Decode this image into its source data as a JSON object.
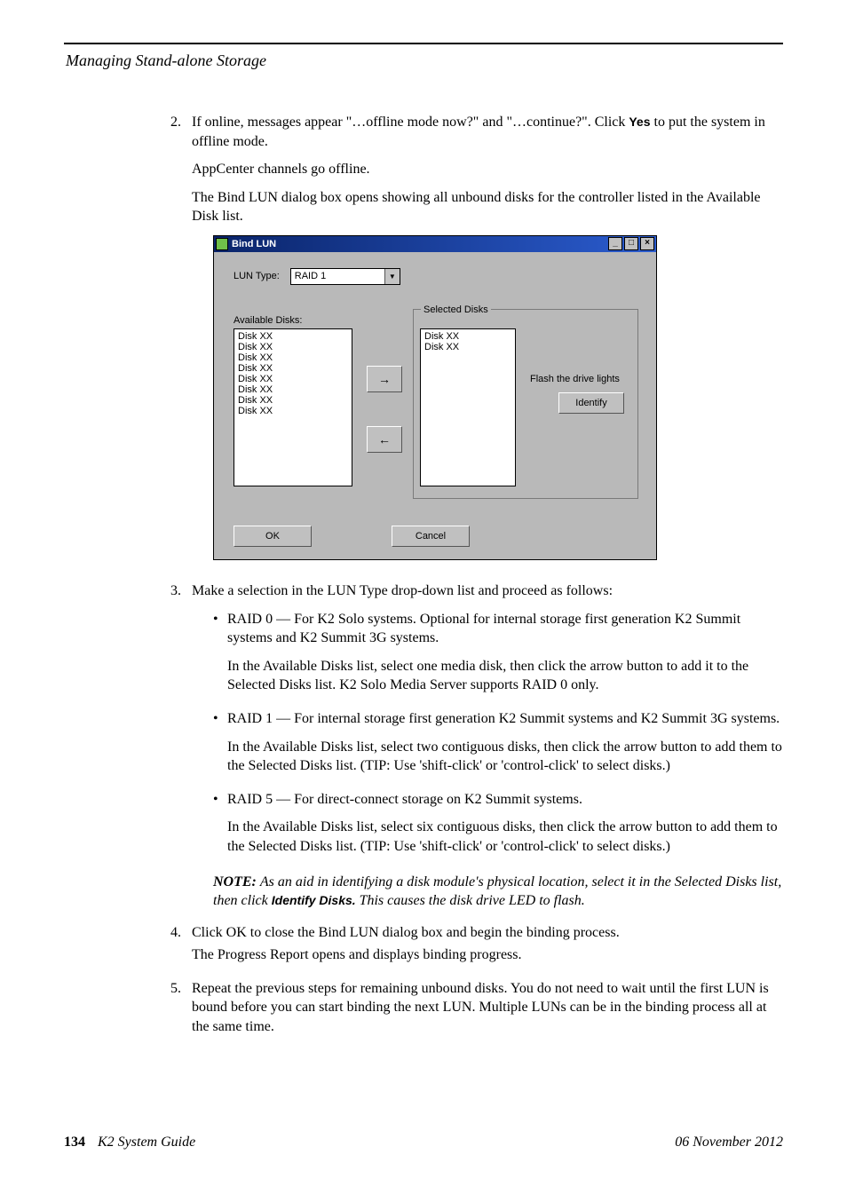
{
  "header": {
    "section_title": "Managing Stand-alone Storage"
  },
  "steps": {
    "s2": {
      "num": "2.",
      "line1a": "If online, messages appear \"…offline mode now?\" and \"…continue?\". Click ",
      "yes": "Yes",
      "line1b": " to put the system in offline mode.",
      "line2": "AppCenter channels go offline.",
      "line3": "The Bind LUN dialog box opens showing all unbound disks for the controller listed in the Available Disk list."
    },
    "s3": {
      "num": "3.",
      "intro": "Make a selection in the LUN Type drop-down list and proceed as follows:",
      "raid0_a": "RAID 0 — For K2 Solo systems. Optional for internal storage first generation K2 Summit systems and K2 Summit 3G systems.",
      "raid0_b": "In the Available Disks list, select one media disk, then click the arrow button to add it to the Selected Disks list. K2 Solo Media Server supports RAID 0 only.",
      "raid1_a": "RAID 1 — For internal storage first generation K2 Summit systems and K2 Summit 3G systems.",
      "raid1_b": "In the Available Disks list, select two contiguous disks, then click the arrow button to add them to the Selected Disks list. (TIP: Use 'shift-click' or 'control-click' to select disks.)",
      "raid5_a": "RAID 5 — For direct-connect storage on K2 Summit systems.",
      "raid5_b": "In the Available Disks list, select six contiguous disks, then click the arrow button to add them to the Selected Disks list. (TIP: Use 'shift-click' or 'control-click' to select disks.)"
    },
    "note": {
      "label": "NOTE:  ",
      "part1": "As an aid in identifying a disk module's physical location, select it in the Selected Disks list, then click ",
      "identify": "Identify Disks. ",
      "part2": "This causes the disk drive LED to flash."
    },
    "s4": {
      "num": "4.",
      "line1": "Click OK to close the Bind LUN dialog box and begin the binding process.",
      "line2": "The Progress Report opens and displays binding progress."
    },
    "s5": {
      "num": "5.",
      "line1": "Repeat the previous steps for remaining unbound disks. You do not need to wait until the first LUN is bound before you can start binding the next LUN. Multiple LUNs can be in the binding process all at the same time."
    }
  },
  "dialog": {
    "title": "Bind LUN",
    "lun_type_label": "LUN Type:",
    "lun_type_value": "RAID 1",
    "available_label": "Available Disks:",
    "available_disks": [
      "Disk XX",
      "Disk XX",
      "Disk XX",
      "Disk XX",
      "Disk XX",
      "Disk XX",
      "Disk XX",
      "Disk XX"
    ],
    "selected_label": "Selected Disks",
    "selected_disks": [
      "Disk XX",
      "Disk XX"
    ],
    "flash_label": "Flash the drive lights",
    "identify_btn": "Identify",
    "ok_btn": "OK",
    "cancel_btn": "Cancel",
    "min_btn": "_",
    "max_btn": "□",
    "close_btn": "×"
  },
  "footer": {
    "page_num": "134",
    "guide": "K2 System Guide",
    "date": "06 November 2012"
  }
}
